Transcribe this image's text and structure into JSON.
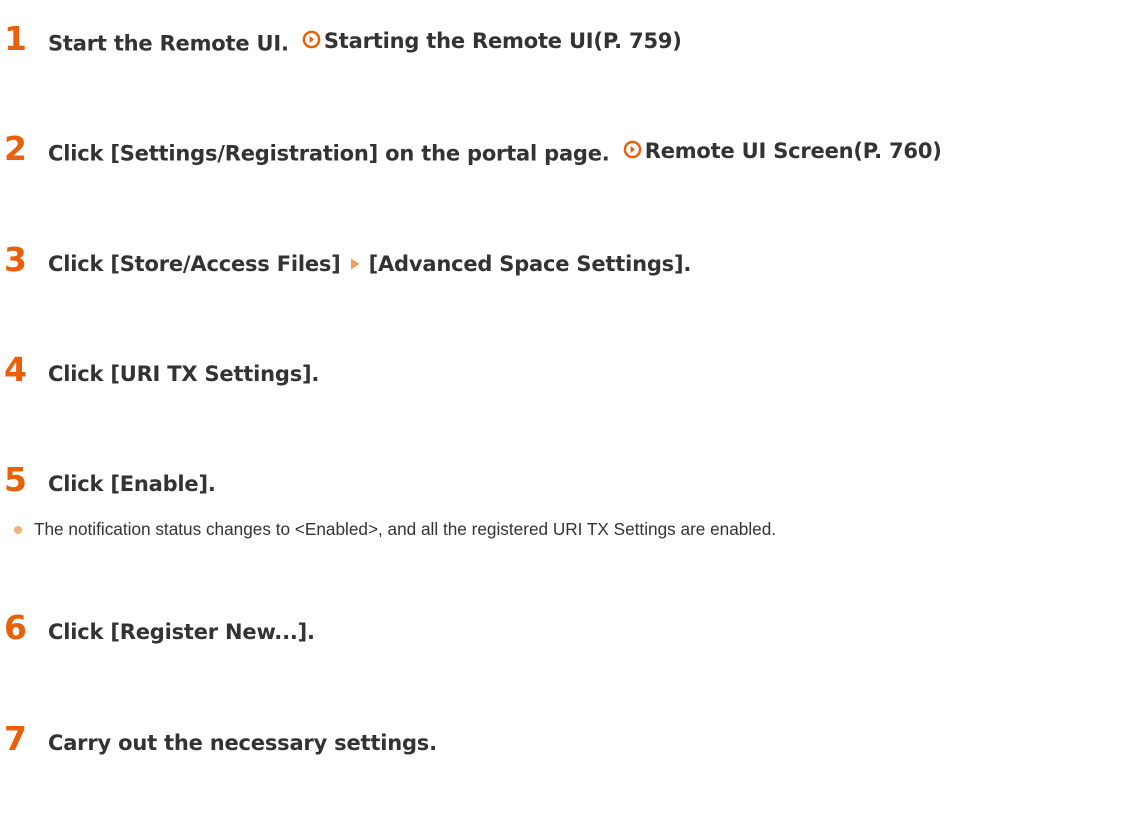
{
  "steps": [
    {
      "num": "1",
      "text": "Start the Remote UI.",
      "link": "Starting the Remote UI(P. 759)"
    },
    {
      "num": "2",
      "text": "Click [Settings/Registration] on the portal page.",
      "link": "Remote UI Screen(P. 760)"
    },
    {
      "num": "3",
      "text_a": "Click [Store/Access Files]",
      "text_b": "[Advanced Space Settings]."
    },
    {
      "num": "4",
      "text": "Click [URI TX Settings]."
    },
    {
      "num": "5",
      "text": "Click [Enable].",
      "note": "The notification status changes to <Enabled>, and all the registered URI TX Settings are enabled."
    },
    {
      "num": "6",
      "text": "Click [Register New...]."
    },
    {
      "num": "7",
      "text": "Carry out the necessary settings."
    }
  ],
  "colors": {
    "accent": "#e8600a",
    "bullet": "#f3b27a",
    "text": "#333333"
  },
  "icons": {
    "link": "circle-arrow-right-icon",
    "separator": "triangle-right-icon"
  }
}
